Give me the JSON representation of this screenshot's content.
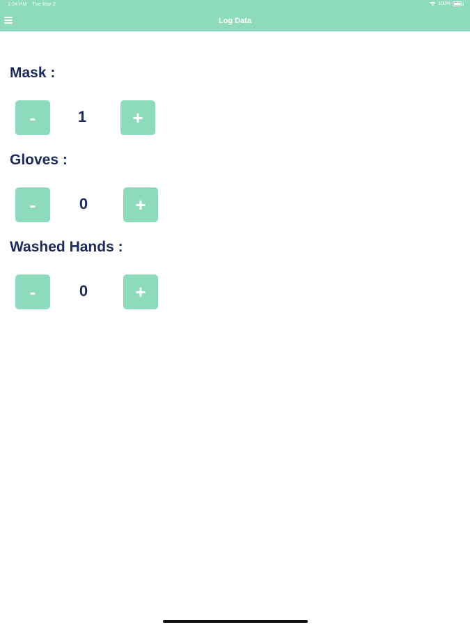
{
  "status_bar": {
    "time": "1:04 PM",
    "date": "Tue Mar 2",
    "battery": "100%",
    "wifi_icon": "wifi-icon",
    "battery_icon": "battery-icon"
  },
  "nav": {
    "title": "Log Data",
    "menu_icon": "hamburger-menu-icon"
  },
  "colors": {
    "accent": "#8ddabd",
    "label_text": "#1b2a5c",
    "background": "#ffffff"
  },
  "counters": [
    {
      "label": "Mask :",
      "minus_label": "-",
      "value": "1",
      "plus_label": "+"
    },
    {
      "label": "Gloves :",
      "minus_label": "-",
      "value": "0",
      "plus_label": "+"
    },
    {
      "label": "Washed Hands :",
      "minus_label": "-",
      "value": "0",
      "plus_label": "+"
    }
  ]
}
